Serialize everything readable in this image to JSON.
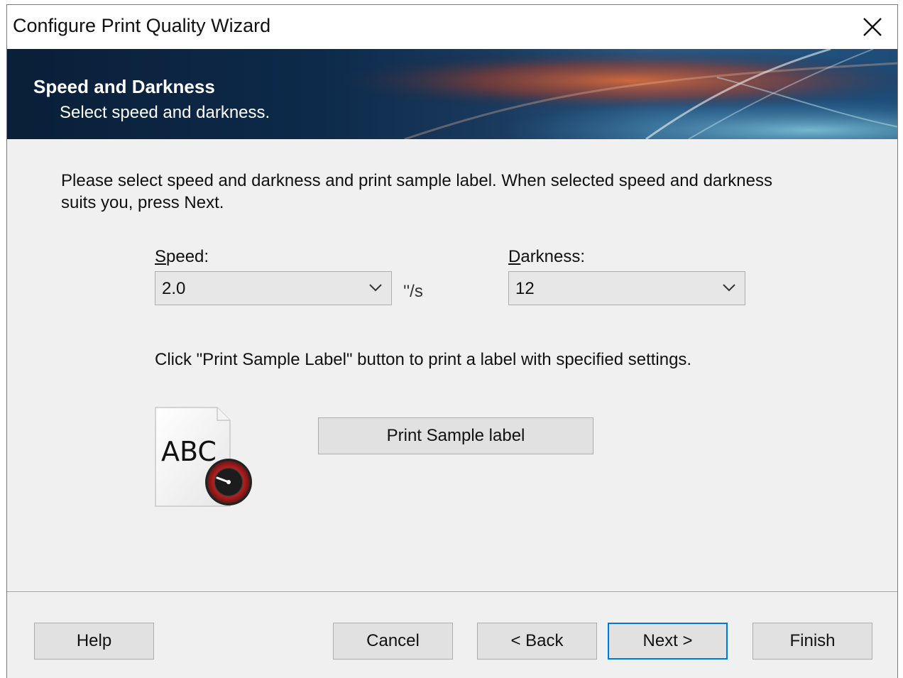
{
  "window": {
    "title": "Configure Print Quality Wizard"
  },
  "banner": {
    "title": "Speed and Darkness",
    "subtitle": "Select speed and darkness."
  },
  "content": {
    "instruction": "Please select speed and darkness and print sample label. When selected speed and darkness suits you, press Next.",
    "speed": {
      "label_accel": "S",
      "label_rest": "peed:",
      "value": "2.0",
      "unit": "''/s"
    },
    "darkness": {
      "label_accel": "D",
      "label_rest": "arkness:",
      "value": "12"
    },
    "hint": "Click \"Print Sample Label\" button to print a label with specified settings.",
    "sample_icon_text": "ABC",
    "print_sample_button": "Print Sample label"
  },
  "footer": {
    "help": "Help",
    "cancel": "Cancel",
    "back": "< Back",
    "next": "Next >",
    "finish": "Finish"
  },
  "colors": {
    "accent": "#0078d7",
    "banner_dark": "#0b2340",
    "banner_orange": "#c8562a",
    "gauge_red": "#b3201e"
  },
  "icons": [
    "close-icon",
    "chevron-down-icon",
    "sample-label-icon",
    "gauge-icon"
  ]
}
